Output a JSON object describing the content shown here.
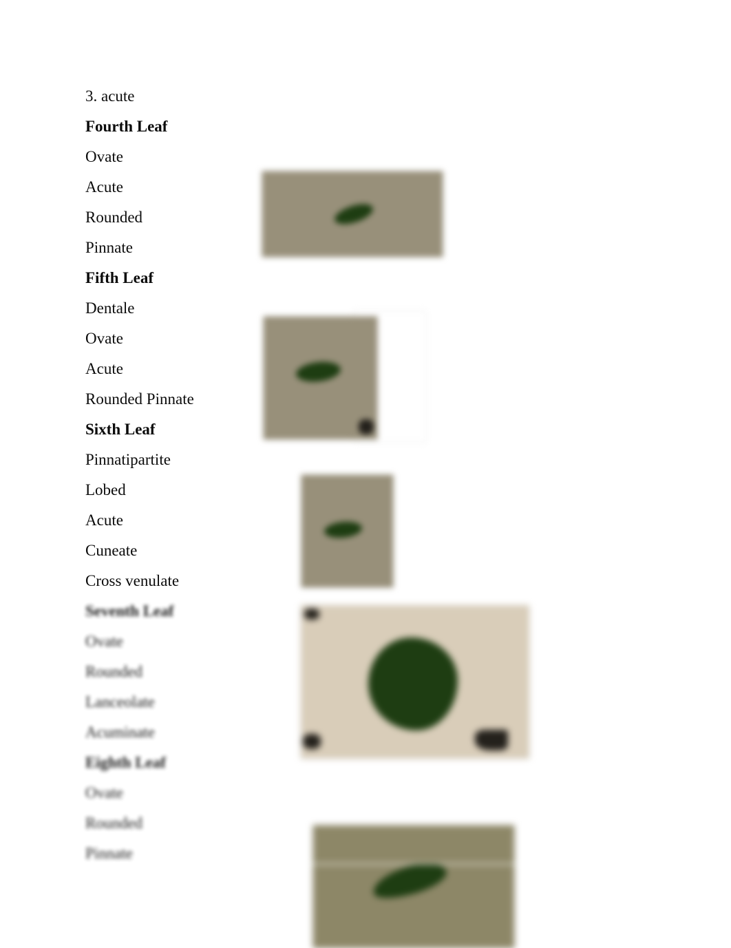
{
  "document": {
    "title": "Leaf Morphology Description Sheet",
    "background_color": "#ffffff",
    "text_color": "#0b0b0b"
  },
  "palette": {
    "photo_khaki": "#98907a",
    "photo_light_beige": "#d9cdb9",
    "photo_olive": "#8d8767",
    "leaf_green": "#1e3d12",
    "corner_mark": "#24211c",
    "white_panel": "#ffffff"
  },
  "content_lines": [
    {
      "text": "3. acute",
      "bold": false,
      "blur": 0
    },
    {
      "text": "Fourth Leaf",
      "bold": true,
      "blur": 0
    },
    {
      "text": "Ovate",
      "bold": false,
      "blur": 0
    },
    {
      "text": "Acute",
      "bold": false,
      "blur": 0
    },
    {
      "text": "Rounded",
      "bold": false,
      "blur": 0
    },
    {
      "text": "Pinnate",
      "bold": false,
      "blur": 0
    },
    {
      "text": "Fifth Leaf",
      "bold": true,
      "blur": 0
    },
    {
      "text": "Dentale",
      "bold": false,
      "blur": 0
    },
    {
      "text": "Ovate",
      "bold": false,
      "blur": 0
    },
    {
      "text": "Acute",
      "bold": false,
      "blur": 0
    },
    {
      "text": "Rounded Pinnate",
      "bold": false,
      "blur": 0
    },
    {
      "text": "Sixth Leaf",
      "bold": true,
      "blur": 0
    },
    {
      "text": "Pinnatipartite",
      "bold": false,
      "blur": 0
    },
    {
      "text": "Lobed",
      "bold": false,
      "blur": 0
    },
    {
      "text": "Acute",
      "bold": false,
      "blur": 0
    },
    {
      "text": "Cuneate",
      "bold": false,
      "blur": 0
    },
    {
      "text": "Cross venulate",
      "bold": false,
      "blur": 0
    },
    {
      "text": "Seventh Leaf",
      "bold": true,
      "blur": 1
    },
    {
      "text": "Ovate",
      "bold": false,
      "blur": 1
    },
    {
      "text": "Rounded",
      "bold": false,
      "blur": 1
    },
    {
      "text": "Lanceolate",
      "bold": false,
      "blur": 1
    },
    {
      "text": "Acuminate",
      "bold": false,
      "blur": 1
    },
    {
      "text": "Eighth Leaf",
      "bold": true,
      "blur": 2
    },
    {
      "text": "Ovate",
      "bold": false,
      "blur": 2
    },
    {
      "text": "Rounded",
      "bold": false,
      "blur": 2
    },
    {
      "text": "Pinnate",
      "bold": false,
      "blur": 2
    }
  ],
  "figures": [
    {
      "name": "fourth-leaf-photo",
      "caption_group": "Fourth Leaf",
      "orientation": "landscape",
      "background": "#98907a",
      "leaf_shape": "small-elongate-ovate",
      "leaf_color": "#1e3d12"
    },
    {
      "name": "fifth-leaf-photo",
      "caption_group": "Fifth Leaf",
      "orientation": "square",
      "background": "#98907a",
      "leaf_shape": "small-elliptic",
      "leaf_color": "#1e3d12",
      "has_white_panel": true,
      "has_corner_mark": true
    },
    {
      "name": "sixth-leaf-photo",
      "caption_group": "Sixth Leaf",
      "orientation": "portrait",
      "background": "#98907a",
      "leaf_shape": "small-elliptic",
      "leaf_color": "#1e3d12"
    },
    {
      "name": "seventh-leaf-photo",
      "caption_group": "Seventh Leaf",
      "orientation": "landscape",
      "background": "#d9cdb9",
      "leaf_shape": "large-round-cordate",
      "leaf_color": "#1e3d12",
      "has_corner_mark": true
    },
    {
      "name": "eighth-leaf-photo",
      "caption_group": "Eighth Leaf",
      "orientation": "landscape",
      "background": "#8d8767",
      "leaf_shape": "elongate-oblique",
      "leaf_color": "#1e3d12",
      "clipped_at_page_bottom": true,
      "has_page_seam": true
    }
  ]
}
